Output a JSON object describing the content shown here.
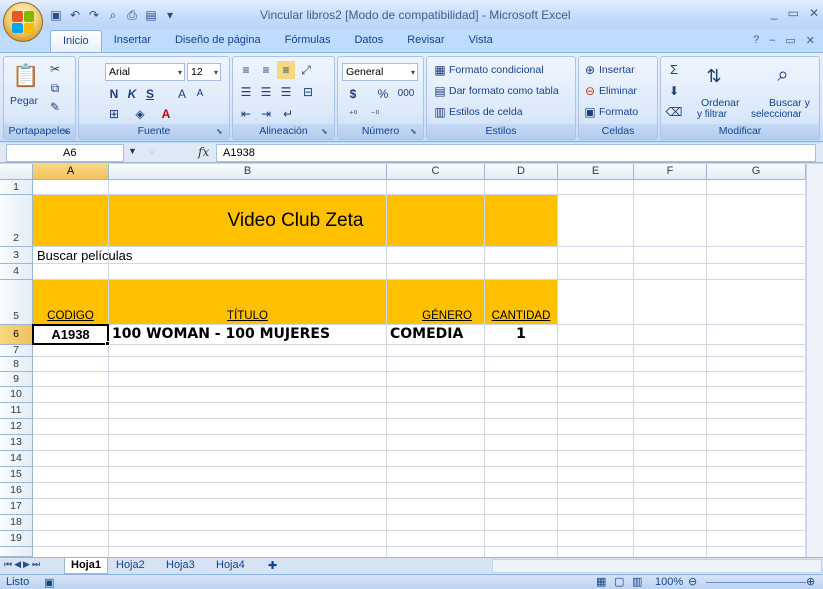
{
  "window": {
    "title": "Vincular libros2  [Modo de compatibilidad] - Microsoft Excel",
    "min": "_",
    "restore": "▭",
    "close": "✕"
  },
  "tabs": [
    "Inicio",
    "Insertar",
    "Diseño de página",
    "Fórmulas",
    "Datos",
    "Revisar",
    "Vista"
  ],
  "ribbon": {
    "clipboard": {
      "label": "Portapapeles",
      "paste": "Pegar"
    },
    "font": {
      "label": "Fuente",
      "name": "Arial",
      "size": "12",
      "bold": "N",
      "italic": "K",
      "underline": "S"
    },
    "alignment": {
      "label": "Alineación"
    },
    "number": {
      "label": "Número",
      "format": "General",
      "currency": "$",
      "percent": "%",
      "thousands": "000"
    },
    "styles": {
      "label": "Estilos",
      "conditional": "Formato condicional",
      "as_table": "Dar formato como tabla",
      "cell_styles": "Estilos de celda"
    },
    "cells": {
      "label": "Celdas",
      "insert": "Insertar",
      "delete": "Eliminar",
      "format": "Formato"
    },
    "editing": {
      "label": "Modificar",
      "sort": "Ordenar",
      "sort2": "y filtrar",
      "find": "Buscar y",
      "find2": "seleccionar"
    }
  },
  "formula_bar": {
    "cell_ref": "A6",
    "fx": "fx",
    "content": "A1938"
  },
  "columns": [
    "A",
    "B",
    "C",
    "D",
    "E",
    "F",
    "G"
  ],
  "rows": [
    "1",
    "2",
    "3",
    "4",
    "5",
    "6",
    "7",
    "8",
    "9",
    "10",
    "11",
    "12",
    "13",
    "14",
    "15",
    "16",
    "17",
    "18",
    "19"
  ],
  "sheet": {
    "title": "Video Club Zeta",
    "search": "Buscar películas",
    "headers": {
      "codigo": "CODIGO",
      "titulo": "TÍTULO",
      "genero": "GÉNERO",
      "cantidad": "CANTIDAD"
    },
    "record": {
      "codigo": "A1938",
      "titulo": "100 WOMAN - 100 MUJERES",
      "genero": "COMEDIA",
      "cantidad": "1"
    }
  },
  "sheet_tabs": [
    "Hoja1",
    "Hoja2",
    "Hoja3",
    "Hoja4"
  ],
  "status": {
    "text": "Listo",
    "zoom": "100%"
  },
  "colors": {
    "header_fill": "#ffc000",
    "selected_header": "#f1c15f"
  }
}
